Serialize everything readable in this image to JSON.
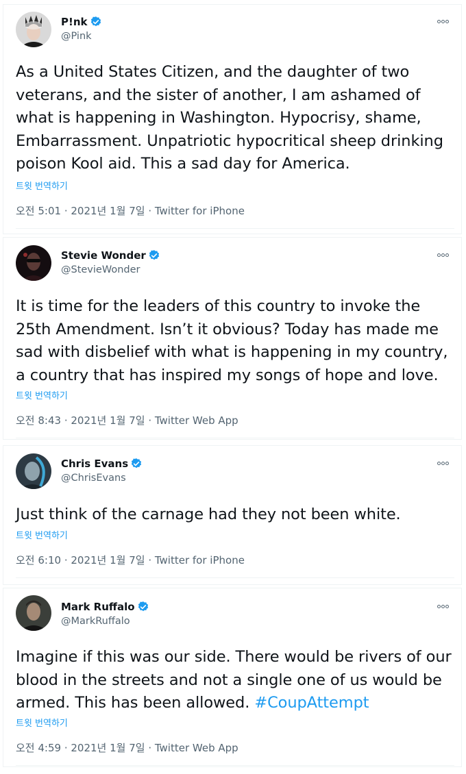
{
  "tweets": [
    {
      "name": "P!nk",
      "handle": "@Pink",
      "text": "As a United States Citizen, and the daughter of two veterans, and the sister of another, I am ashamed of what is happening in Washington. Hypocrisy, shame, Embarrassment. Unpatriotic hypocritical sheep drinking poison Kool aid. This a sad day for America.",
      "translate": "트윗 번역하기",
      "time": "오전 5:01 · 2021년 1월 7일 · ",
      "source": "Twitter for iPhone"
    },
    {
      "name": "Stevie Wonder",
      "handle": "@StevieWonder",
      "text": "It is time for the leaders of this country to invoke the 25th Amendment.  Isn’t it obvious?  Today has made me sad with disbelief with what is happening in my country, a country that has inspired my songs of hope and love.",
      "translate": "트윗 번역하기",
      "time": "오전 8:43 · 2021년 1월 7일 · ",
      "source": "Twitter Web App"
    },
    {
      "name": "Chris Evans",
      "handle": "@ChrisEvans",
      "text": "Just think of the carnage had they not been white.",
      "translate": "트윗 번역하기",
      "time": "오전 6:10 · 2021년 1월 7일 · ",
      "source": "Twitter for iPhone"
    },
    {
      "name": "Mark Ruffalo",
      "handle": "@MarkRuffalo",
      "text": "Imagine if this was our side. There would be rivers of our blood in the streets and not a single one of us would be armed. This has been allowed. ",
      "hashtag": "#CoupAttempt",
      "translate": "트윗 번역하기",
      "time": "오전 4:59 · 2021년 1월 7일 · ",
      "source": "Twitter Web App"
    }
  ],
  "colors": {
    "link": "#1d9bf0",
    "secondary_text": "#536471",
    "verified_badge": "#1d9bf0"
  },
  "icons": {
    "verified": "verified-badge-icon",
    "more": "more-options-icon"
  }
}
